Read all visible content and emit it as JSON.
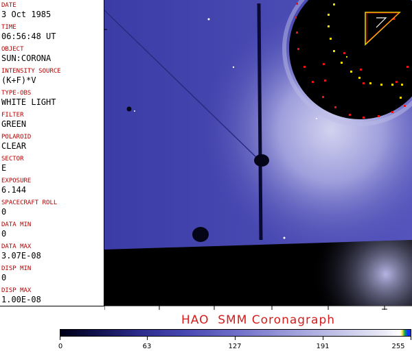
{
  "fields": [
    {
      "label": "DATE",
      "value": "3 Oct 1985"
    },
    {
      "label": "TIME",
      "value": "06:56:48 UT"
    },
    {
      "label": "OBJECT",
      "value": "SUN:CORONA"
    },
    {
      "label": "INTENSITY SOURCE",
      "value": "(K+F)*V"
    },
    {
      "label": "TYPE-OBS",
      "value": "WHITE LIGHT"
    },
    {
      "label": "FILTER",
      "value": "GREEN"
    },
    {
      "label": "POLAROID",
      "value": "CLEAR"
    },
    {
      "label": "SECTOR",
      "value": "E"
    },
    {
      "label": "EXPOSURE",
      "value": "6.144"
    },
    {
      "label": "SPACECRAFT ROLL",
      "value": "0"
    },
    {
      "label": "DATA MIN",
      "value": "0"
    },
    {
      "label": "DATA MAX",
      "value": "3.07E-08"
    },
    {
      "label": "DISP MIN",
      "value": "0"
    },
    {
      "label": "DISP MAX",
      "value": "1.00E-08"
    }
  ],
  "title": "HAO  SMM Coronagraph",
  "colorbar": {
    "min": 0,
    "max": 255,
    "ticks": [
      "0",
      "63",
      "127",
      "191",
      "255"
    ]
  },
  "colors": {
    "label": "#b40000",
    "title": "#d21e1e",
    "corona": "#4b4bb4",
    "occulter_marker_red": "#e61414",
    "occulter_marker_yellow": "#f0dc00"
  }
}
